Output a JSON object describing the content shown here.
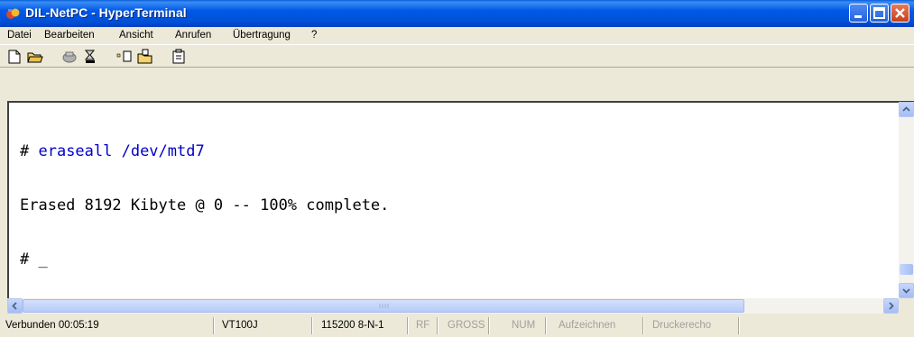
{
  "window": {
    "title": "DIL-NetPC - HyperTerminal"
  },
  "menu": [
    "Datei",
    "Bearbeiten",
    "Ansicht",
    "Anrufen",
    "Übertragung",
    "?"
  ],
  "terminal": {
    "lines": [
      {
        "prompt": "# ",
        "command": "eraseall /dev/mtd7"
      },
      {
        "text": "Erased 8192 Kibyte @ 0 -- 100% complete."
      },
      {
        "text": "# _"
      }
    ]
  },
  "status": {
    "connected": "Verbunden 00:05:19",
    "emulation": "VT100J",
    "port_settings": "115200 8-N-1",
    "rf": "RF",
    "gross": "GROSS",
    "num": "NUM",
    "capture": "Aufzeichnen",
    "print_echo": "Druckerecho"
  }
}
